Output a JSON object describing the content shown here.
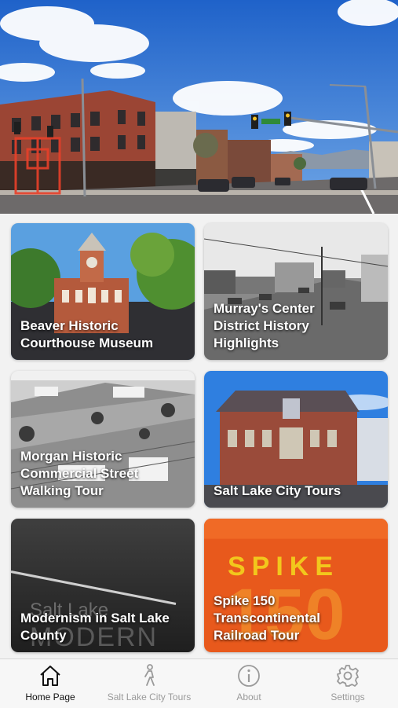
{
  "hero": {
    "sign_left": "",
    "sign_right": ""
  },
  "tiles": [
    {
      "label": "Beaver Historic\nCourthouse Museum"
    },
    {
      "label": "Murray's Center\nDistrict History\nHighlights"
    },
    {
      "label": "Morgan Historic\nCommercial Street\nWalking Tour"
    },
    {
      "label": "Salt Lake City Tours"
    },
    {
      "label": "Modernism in Salt Lake\nCounty",
      "bg_text_1": "Salt Lake",
      "bg_text_2": "MODERN"
    },
    {
      "label": "Spike 150\nTranscontinental\nRailroad Tour",
      "bg_text_1": "SPIKE",
      "bg_text_2": "150"
    }
  ],
  "tabbar": {
    "items": [
      {
        "label": "Home Page",
        "icon": "home-icon",
        "active": true
      },
      {
        "label": "Salt Lake City Tours",
        "icon": "walking-person-icon",
        "active": false
      },
      {
        "label": "About",
        "icon": "info-icon",
        "active": false
      },
      {
        "label": "Settings",
        "icon": "gear-icon",
        "active": false
      }
    ]
  },
  "colors": {
    "active_tab": "#111111",
    "inactive_tab": "#9a9a9a",
    "spike_orange": "#e8591c",
    "brick": "#a54a36"
  }
}
